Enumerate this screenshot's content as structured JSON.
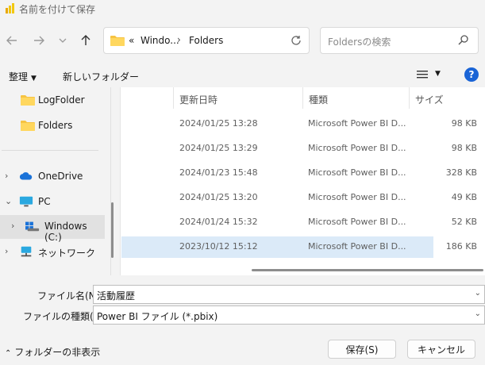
{
  "window": {
    "title": "名前を付けて保存"
  },
  "nav": {
    "back_icon": "arrow-left-icon",
    "forward_icon": "arrow-right-icon",
    "recent_icon": "chevron-down-icon",
    "up_icon": "arrow-up-icon"
  },
  "address": {
    "overflow": "«",
    "crumbs": [
      "Windo...",
      "Folders"
    ],
    "separator": "›"
  },
  "search": {
    "placeholder": "Foldersの検索"
  },
  "toolbar": {
    "organize": "整理",
    "new_folder": "新しいフォルダー",
    "help": "?"
  },
  "sidebar": {
    "items": [
      {
        "label": "LogFolder"
      },
      {
        "label": "Folders"
      },
      {
        "label": "OneDrive"
      },
      {
        "label": "PC"
      },
      {
        "label": "Windows (C:)"
      },
      {
        "label": "ネットワーク"
      }
    ]
  },
  "table": {
    "headers": [
      "更新日時",
      "種類",
      "サイズ"
    ],
    "rows": [
      {
        "date": "2024/01/25 13:28",
        "type": "Microsoft Power BI D...",
        "size": "98 KB"
      },
      {
        "date": "2024/01/25 13:29",
        "type": "Microsoft Power BI D...",
        "size": "98 KB"
      },
      {
        "date": "2024/01/23 15:48",
        "type": "Microsoft Power BI D...",
        "size": "328 KB"
      },
      {
        "date": "2024/01/25 13:20",
        "type": "Microsoft Power BI D...",
        "size": "49 KB"
      },
      {
        "date": "2024/01/24 15:32",
        "type": "Microsoft Power BI D...",
        "size": "52 KB"
      },
      {
        "date": "2023/10/12 15:12",
        "type": "Microsoft Power BI D...",
        "size": "186 KB"
      }
    ]
  },
  "form": {
    "filename_label": "ファイル名(N):",
    "filename_value": "活動履歴",
    "filetype_label": "ファイルの種類(T):",
    "filetype_value": "Power BI ファイル (*.pbix)"
  },
  "footer": {
    "hide_folders": "フォルダーの非表示",
    "save": "保存(S)",
    "cancel": "キャンセル"
  },
  "colors": {
    "folder": "#f6c342",
    "accent": "#1a64d6",
    "selection": "#dbeaf8"
  }
}
